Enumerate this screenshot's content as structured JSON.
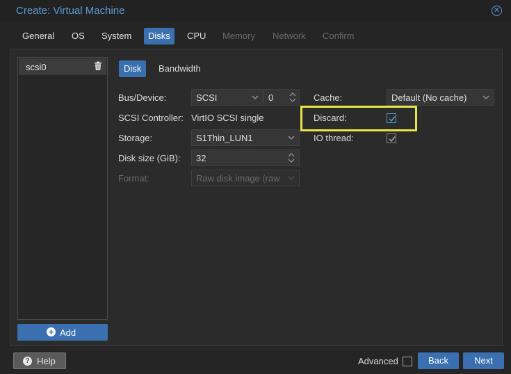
{
  "window": {
    "title": "Create: Virtual Machine"
  },
  "tabs": [
    {
      "label": "General",
      "state": "normal"
    },
    {
      "label": "OS",
      "state": "normal"
    },
    {
      "label": "System",
      "state": "normal"
    },
    {
      "label": "Disks",
      "state": "active"
    },
    {
      "label": "CPU",
      "state": "normal"
    },
    {
      "label": "Memory",
      "state": "disabled"
    },
    {
      "label": "Network",
      "state": "disabled"
    },
    {
      "label": "Confirm",
      "state": "disabled"
    }
  ],
  "disk_list": {
    "items": [
      {
        "label": "scsi0",
        "icon": "trash-icon"
      }
    ],
    "add_label": "Add"
  },
  "subtabs": [
    {
      "label": "Disk",
      "state": "active"
    },
    {
      "label": "Bandwidth",
      "state": "normal"
    }
  ],
  "form": {
    "bus_device": {
      "label": "Bus/Device:",
      "bus": "SCSI",
      "device": "0"
    },
    "scsi_controller": {
      "label": "SCSI Controller:",
      "value": "VirtIO SCSI single"
    },
    "storage": {
      "label": "Storage:",
      "value": "S1Thin_LUN1"
    },
    "disk_size": {
      "label": "Disk size (GiB):",
      "value": "32"
    },
    "format": {
      "label": "Format:",
      "value": "Raw disk image (raw"
    },
    "cache": {
      "label": "Cache:",
      "value": "Default (No cache)"
    },
    "discard": {
      "label": "Discard:",
      "checked": true
    },
    "io_thread": {
      "label": "IO thread:",
      "checked": true
    }
  },
  "footer": {
    "help_label": "Help",
    "advanced_label": "Advanced",
    "advanced_checked": false,
    "back_label": "Back",
    "next_label": "Next"
  },
  "colors": {
    "accent": "#3a6fb0",
    "title": "#5b9bd5",
    "highlight": "#e8e44a",
    "background": "#252525"
  }
}
